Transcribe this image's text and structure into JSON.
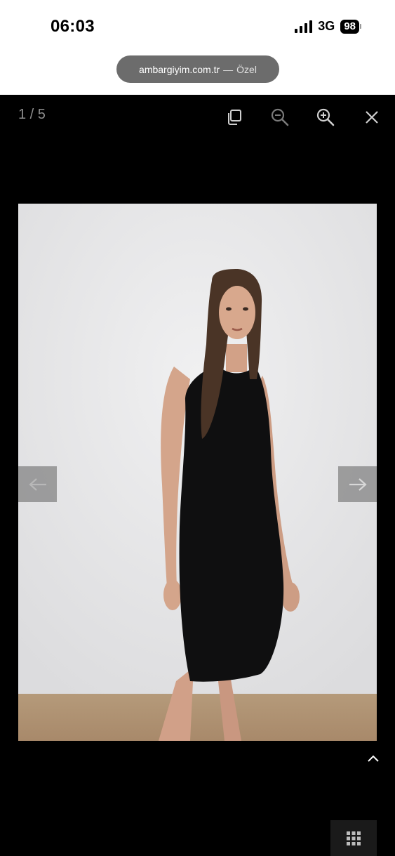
{
  "status_bar": {
    "time": "06:03",
    "network": "3G",
    "battery": "98",
    "signal_bars": 4
  },
  "browser": {
    "url": "ambargiyim.com.tr",
    "separator": "—",
    "mode": "Özel"
  },
  "lightbox": {
    "counter": "1 / 5",
    "icons": {
      "fullscreen": "fullscreen-icon",
      "zoom_out": "zoom-out-icon",
      "zoom_in": "zoom-in-icon",
      "close": "close-icon",
      "prev": "arrow-left-icon",
      "next": "arrow-right-icon",
      "scroll_up": "chevron-up-icon",
      "thumbnails": "grid-icon"
    }
  },
  "colors": {
    "background": "#000000",
    "toolbar_icon": "#cfcfcf",
    "toolbar_icon_disabled": "#7a7a7a",
    "nav_button": "#808080",
    "url_pill": "#6c6c6c"
  }
}
